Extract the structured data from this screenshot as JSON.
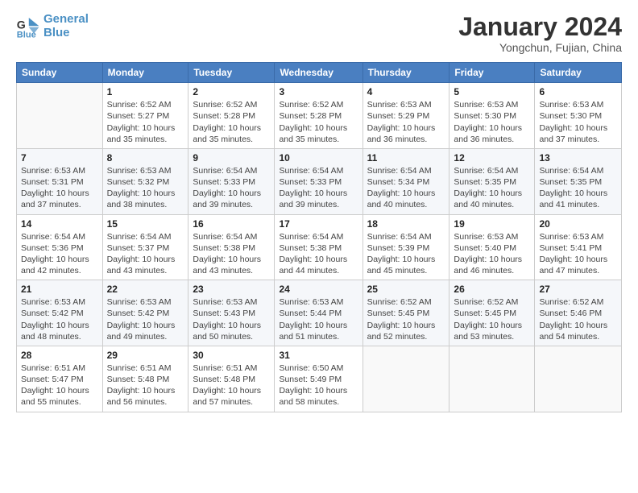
{
  "logo": {
    "line1": "General",
    "line2": "Blue"
  },
  "header": {
    "month_title": "January 2024",
    "subtitle": "Yongchun, Fujian, China"
  },
  "weekdays": [
    "Sunday",
    "Monday",
    "Tuesday",
    "Wednesday",
    "Thursday",
    "Friday",
    "Saturday"
  ],
  "weeks": [
    [
      {
        "day": "",
        "sunrise": "",
        "sunset": "",
        "daylight": ""
      },
      {
        "day": "1",
        "sunrise": "6:52 AM",
        "sunset": "5:27 PM",
        "daylight": "10 hours and 35 minutes."
      },
      {
        "day": "2",
        "sunrise": "6:52 AM",
        "sunset": "5:28 PM",
        "daylight": "10 hours and 35 minutes."
      },
      {
        "day": "3",
        "sunrise": "6:52 AM",
        "sunset": "5:28 PM",
        "daylight": "10 hours and 35 minutes."
      },
      {
        "day": "4",
        "sunrise": "6:53 AM",
        "sunset": "5:29 PM",
        "daylight": "10 hours and 36 minutes."
      },
      {
        "day": "5",
        "sunrise": "6:53 AM",
        "sunset": "5:30 PM",
        "daylight": "10 hours and 36 minutes."
      },
      {
        "day": "6",
        "sunrise": "6:53 AM",
        "sunset": "5:30 PM",
        "daylight": "10 hours and 37 minutes."
      }
    ],
    [
      {
        "day": "7",
        "sunrise": "6:53 AM",
        "sunset": "5:31 PM",
        "daylight": "10 hours and 37 minutes."
      },
      {
        "day": "8",
        "sunrise": "6:53 AM",
        "sunset": "5:32 PM",
        "daylight": "10 hours and 38 minutes."
      },
      {
        "day": "9",
        "sunrise": "6:54 AM",
        "sunset": "5:33 PM",
        "daylight": "10 hours and 39 minutes."
      },
      {
        "day": "10",
        "sunrise": "6:54 AM",
        "sunset": "5:33 PM",
        "daylight": "10 hours and 39 minutes."
      },
      {
        "day": "11",
        "sunrise": "6:54 AM",
        "sunset": "5:34 PM",
        "daylight": "10 hours and 40 minutes."
      },
      {
        "day": "12",
        "sunrise": "6:54 AM",
        "sunset": "5:35 PM",
        "daylight": "10 hours and 40 minutes."
      },
      {
        "day": "13",
        "sunrise": "6:54 AM",
        "sunset": "5:35 PM",
        "daylight": "10 hours and 41 minutes."
      }
    ],
    [
      {
        "day": "14",
        "sunrise": "6:54 AM",
        "sunset": "5:36 PM",
        "daylight": "10 hours and 42 minutes."
      },
      {
        "day": "15",
        "sunrise": "6:54 AM",
        "sunset": "5:37 PM",
        "daylight": "10 hours and 43 minutes."
      },
      {
        "day": "16",
        "sunrise": "6:54 AM",
        "sunset": "5:38 PM",
        "daylight": "10 hours and 43 minutes."
      },
      {
        "day": "17",
        "sunrise": "6:54 AM",
        "sunset": "5:38 PM",
        "daylight": "10 hours and 44 minutes."
      },
      {
        "day": "18",
        "sunrise": "6:54 AM",
        "sunset": "5:39 PM",
        "daylight": "10 hours and 45 minutes."
      },
      {
        "day": "19",
        "sunrise": "6:53 AM",
        "sunset": "5:40 PM",
        "daylight": "10 hours and 46 minutes."
      },
      {
        "day": "20",
        "sunrise": "6:53 AM",
        "sunset": "5:41 PM",
        "daylight": "10 hours and 47 minutes."
      }
    ],
    [
      {
        "day": "21",
        "sunrise": "6:53 AM",
        "sunset": "5:42 PM",
        "daylight": "10 hours and 48 minutes."
      },
      {
        "day": "22",
        "sunrise": "6:53 AM",
        "sunset": "5:42 PM",
        "daylight": "10 hours and 49 minutes."
      },
      {
        "day": "23",
        "sunrise": "6:53 AM",
        "sunset": "5:43 PM",
        "daylight": "10 hours and 50 minutes."
      },
      {
        "day": "24",
        "sunrise": "6:53 AM",
        "sunset": "5:44 PM",
        "daylight": "10 hours and 51 minutes."
      },
      {
        "day": "25",
        "sunrise": "6:52 AM",
        "sunset": "5:45 PM",
        "daylight": "10 hours and 52 minutes."
      },
      {
        "day": "26",
        "sunrise": "6:52 AM",
        "sunset": "5:45 PM",
        "daylight": "10 hours and 53 minutes."
      },
      {
        "day": "27",
        "sunrise": "6:52 AM",
        "sunset": "5:46 PM",
        "daylight": "10 hours and 54 minutes."
      }
    ],
    [
      {
        "day": "28",
        "sunrise": "6:51 AM",
        "sunset": "5:47 PM",
        "daylight": "10 hours and 55 minutes."
      },
      {
        "day": "29",
        "sunrise": "6:51 AM",
        "sunset": "5:48 PM",
        "daylight": "10 hours and 56 minutes."
      },
      {
        "day": "30",
        "sunrise": "6:51 AM",
        "sunset": "5:48 PM",
        "daylight": "10 hours and 57 minutes."
      },
      {
        "day": "31",
        "sunrise": "6:50 AM",
        "sunset": "5:49 PM",
        "daylight": "10 hours and 58 minutes."
      },
      {
        "day": "",
        "sunrise": "",
        "sunset": "",
        "daylight": ""
      },
      {
        "day": "",
        "sunrise": "",
        "sunset": "",
        "daylight": ""
      },
      {
        "day": "",
        "sunrise": "",
        "sunset": "",
        "daylight": ""
      }
    ]
  ]
}
